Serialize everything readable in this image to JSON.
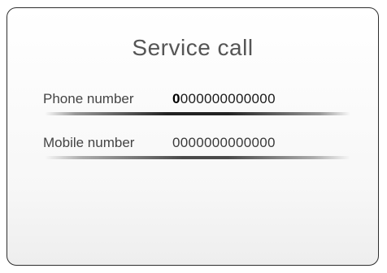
{
  "dialog": {
    "title": "Service call",
    "fields": [
      {
        "label": "Phone number",
        "value_first": "0",
        "value_rest": "000000000000",
        "focused": true
      },
      {
        "label": "Mobile number",
        "value": "0000000000000",
        "focused": false
      }
    ]
  },
  "colors": {
    "border": "#2e2e2e",
    "text": "#444444",
    "underline_active": "#222222",
    "underline_inactive": "#4a4a4a"
  }
}
